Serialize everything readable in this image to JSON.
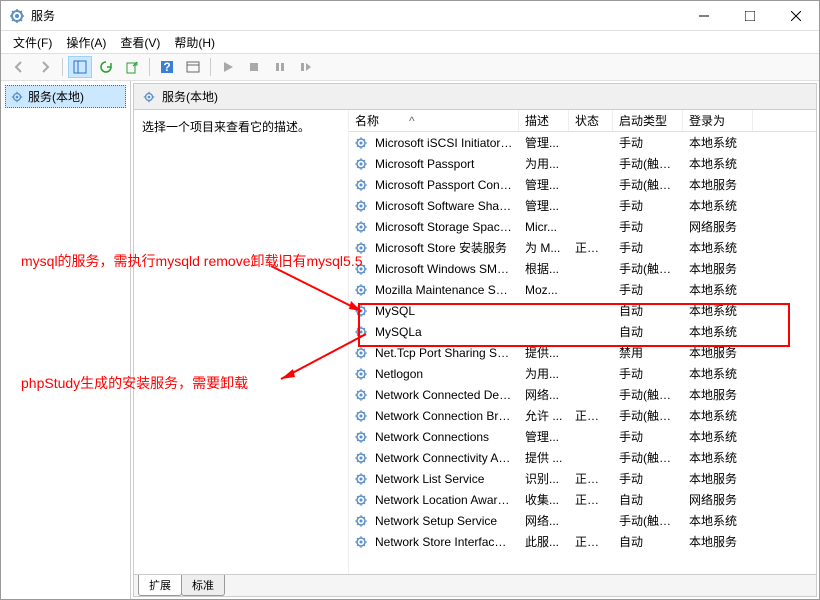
{
  "window": {
    "title": "服务",
    "min": "—",
    "max": "□",
    "close": "✕"
  },
  "menu": {
    "file": "文件(F)",
    "action": "操作(A)",
    "view": "查看(V)",
    "help": "帮助(H)"
  },
  "tree": {
    "root": "服务(本地)"
  },
  "detail": {
    "header": "服务(本地)",
    "desc": "选择一个项目来查看它的描述。"
  },
  "columns": {
    "name": "名称",
    "desc": "描述",
    "status": "状态",
    "start": "启动类型",
    "logon": "登录为"
  },
  "tabs": {
    "extended": "扩展",
    "standard": "标准"
  },
  "annotations": {
    "line1": "mysql的服务，需执行mysqld remove卸载旧有mysql5.5",
    "line2": "phpStudy生成的安装服务，需要卸载"
  },
  "services": [
    {
      "name": "Microsoft iSCSI Initiator ...",
      "desc": "管理...",
      "status": "",
      "start": "手动",
      "logon": "本地系统"
    },
    {
      "name": "Microsoft Passport",
      "desc": "为用...",
      "status": "",
      "start": "手动(触发...",
      "logon": "本地系统"
    },
    {
      "name": "Microsoft Passport Cont...",
      "desc": "管理...",
      "status": "",
      "start": "手动(触发...",
      "logon": "本地服务"
    },
    {
      "name": "Microsoft Software Shad...",
      "desc": "管理...",
      "status": "",
      "start": "手动",
      "logon": "本地系统"
    },
    {
      "name": "Microsoft Storage Space...",
      "desc": "Micr...",
      "status": "",
      "start": "手动",
      "logon": "网络服务"
    },
    {
      "name": "Microsoft Store 安装服务",
      "desc": "为 M...",
      "status": "正在...",
      "start": "手动",
      "logon": "本地系统"
    },
    {
      "name": "Microsoft Windows SMS ...",
      "desc": "根据...",
      "status": "",
      "start": "手动(触发...",
      "logon": "本地服务"
    },
    {
      "name": "Mozilla Maintenance Ser...",
      "desc": "Moz...",
      "status": "",
      "start": "手动",
      "logon": "本地系统"
    },
    {
      "name": "MySQL",
      "desc": "",
      "status": "",
      "start": "自动",
      "logon": "本地系统"
    },
    {
      "name": "MySQLa",
      "desc": "",
      "status": "",
      "start": "自动",
      "logon": "本地系统"
    },
    {
      "name": "Net.Tcp Port Sharing Ser...",
      "desc": "提供...",
      "status": "",
      "start": "禁用",
      "logon": "本地服务"
    },
    {
      "name": "Netlogon",
      "desc": "为用...",
      "status": "",
      "start": "手动",
      "logon": "本地系统"
    },
    {
      "name": "Network Connected Devi...",
      "desc": "网络...",
      "status": "",
      "start": "手动(触发...",
      "logon": "本地服务"
    },
    {
      "name": "Network Connection Bro...",
      "desc": "允许 ...",
      "status": "正在...",
      "start": "手动(触发...",
      "logon": "本地系统"
    },
    {
      "name": "Network Connections",
      "desc": "管理...",
      "status": "",
      "start": "手动",
      "logon": "本地系统"
    },
    {
      "name": "Network Connectivity Ass...",
      "desc": "提供 ...",
      "status": "",
      "start": "手动(触发...",
      "logon": "本地系统"
    },
    {
      "name": "Network List Service",
      "desc": "识别...",
      "status": "正在...",
      "start": "手动",
      "logon": "本地服务"
    },
    {
      "name": "Network Location Aware...",
      "desc": "收集...",
      "status": "正在...",
      "start": "自动",
      "logon": "网络服务"
    },
    {
      "name": "Network Setup Service",
      "desc": "网络...",
      "status": "",
      "start": "手动(触发...",
      "logon": "本地系统"
    },
    {
      "name": "Network Store Interface ...",
      "desc": "此服...",
      "status": "正在...",
      "start": "自动",
      "logon": "本地服务"
    }
  ]
}
